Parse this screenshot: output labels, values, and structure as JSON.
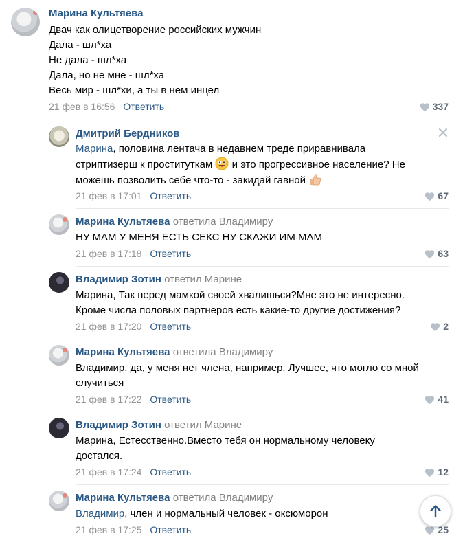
{
  "colors": {
    "link": "#2a5885",
    "meta": "#939393",
    "likes": "#5e6a78"
  },
  "comments": [
    {
      "author": "Марина Культяева",
      "reply_to": "",
      "lines": [
        "Двач как олицетворение российских мужчин",
        "Дала - шл*ха",
        "Не дала - шл*ха",
        "Дала, но не мне - шл*ха",
        "Весь мир - шл*хи, а ты в нем инцел"
      ],
      "date": "21 фев в 16:56",
      "reply_label": "Ответить",
      "likes": "337"
    },
    {
      "author": "Дмитрий Бердников",
      "reply_to": "",
      "mention": "Марина",
      "line1_rest": ", половина лентача в недавнем треде приравнивала",
      "line2_a": "стриптизерш к проституткам",
      "line2_b": " и это прогрессивное население? Не",
      "line3": "можешь позволить себе что-то - закидай гавной",
      "date": "21 фев в 17:01",
      "reply_label": "Ответить",
      "likes": "67",
      "close_icon": "close-icon"
    },
    {
      "author": "Марина Культяева",
      "reply_to": "ответила Владимиру",
      "lines": [
        "НУ МАМ У МЕНЯ ЕСТЬ СЕКС НУ СКАЖИ ИМ МАМ"
      ],
      "date": "21 фев в 17:18",
      "reply_label": "Ответить",
      "likes": "63"
    },
    {
      "author": "Владимир Зотин",
      "reply_to": "ответил Марине",
      "lines": [
        "Марина, Так перед мамкой своей хвалишься?Мне это не интересно.",
        "Кроме числа половых партнеров есть какие-то другие достижения?"
      ],
      "date": "21 фев в 17:20",
      "reply_label": "Ответить",
      "likes": "2"
    },
    {
      "author": "Марина Культяева",
      "reply_to": "ответила Владимиру",
      "lines": [
        "Владимир, да, у меня нет члена, например. Лучшее, что могло со мной",
        "случиться"
      ],
      "date": "21 фев в 17:22",
      "reply_label": "Ответить",
      "likes": "41"
    },
    {
      "author": "Владимир Зотин",
      "reply_to": "ответил Марине",
      "lines": [
        "Марина, Естесственно.Вместо тебя он нормальному человеку",
        "достался."
      ],
      "date": "21 фев в 17:24",
      "reply_label": "Ответить",
      "likes": "12"
    },
    {
      "author": "Марина Культяева",
      "reply_to": "ответила Владимиру",
      "mention": "Владимир",
      "line1_rest": ", член и нормальный человек - оксюморон",
      "date": "21 фев в 17:25",
      "reply_label": "Ответить",
      "likes": "25"
    }
  ],
  "scroll_up_icon": "arrow-up-icon"
}
